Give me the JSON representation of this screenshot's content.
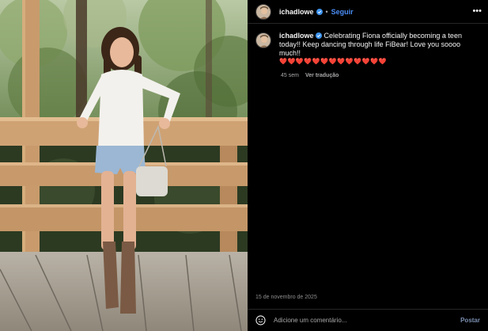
{
  "post": {
    "username": "ichadlowe",
    "follow_label": "Seguir",
    "separator": "•",
    "more_label": "•••",
    "caption": "Celebrating Fiona officially becoming a teen today!! Keep dancing through life FiBear! Love you soooo much!!",
    "hearts": "❤️❤️❤️❤️❤️❤️❤️❤️❤️❤️❤️❤️❤️",
    "age": "45 sem",
    "translate_label": "Ver tradução",
    "date": "15 de novembro de 2025"
  },
  "comment_box": {
    "placeholder": "Adicione um comentário...",
    "post_label": "Postar"
  },
  "colors": {
    "accent": "#4b8ef7",
    "background": "#000000",
    "heart": "#ef3e4a"
  },
  "icons": {
    "verified": "verified-badge-icon",
    "more": "more-options-icon",
    "emoji": "emoji-icon"
  }
}
